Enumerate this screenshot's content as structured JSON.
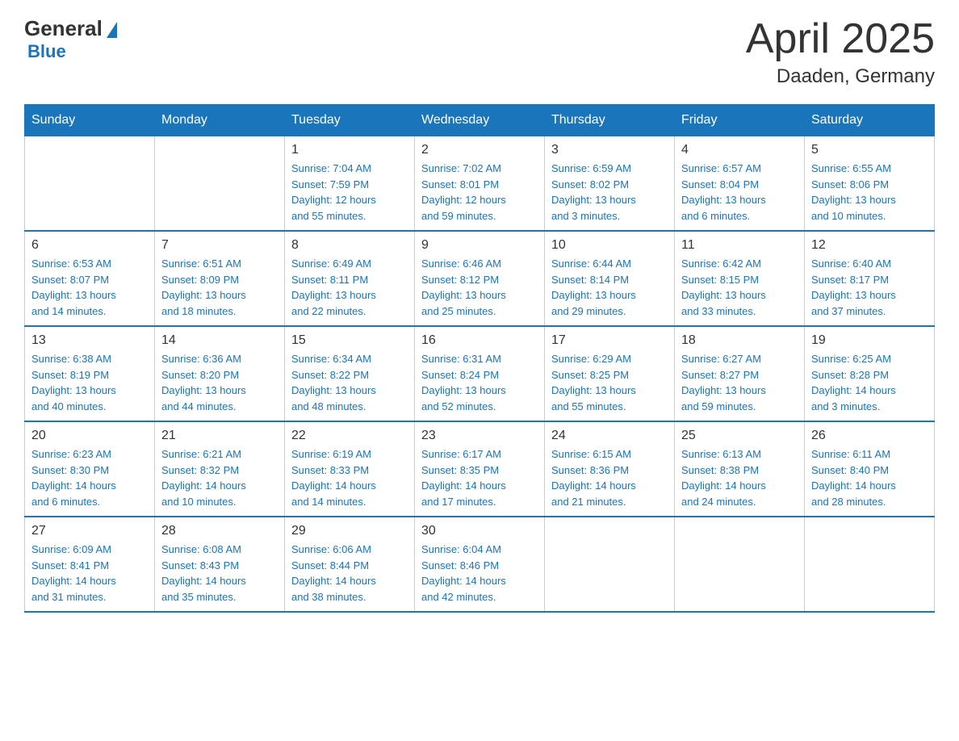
{
  "header": {
    "logo": {
      "general": "General",
      "blue": "Blue"
    },
    "title": "April 2025",
    "subtitle": "Daaden, Germany"
  },
  "calendar": {
    "days_of_week": [
      "Sunday",
      "Monday",
      "Tuesday",
      "Wednesday",
      "Thursday",
      "Friday",
      "Saturday"
    ],
    "weeks": [
      [
        {
          "day": "",
          "info": ""
        },
        {
          "day": "",
          "info": ""
        },
        {
          "day": "1",
          "info": "Sunrise: 7:04 AM\nSunset: 7:59 PM\nDaylight: 12 hours\nand 55 minutes."
        },
        {
          "day": "2",
          "info": "Sunrise: 7:02 AM\nSunset: 8:01 PM\nDaylight: 12 hours\nand 59 minutes."
        },
        {
          "day": "3",
          "info": "Sunrise: 6:59 AM\nSunset: 8:02 PM\nDaylight: 13 hours\nand 3 minutes."
        },
        {
          "day": "4",
          "info": "Sunrise: 6:57 AM\nSunset: 8:04 PM\nDaylight: 13 hours\nand 6 minutes."
        },
        {
          "day": "5",
          "info": "Sunrise: 6:55 AM\nSunset: 8:06 PM\nDaylight: 13 hours\nand 10 minutes."
        }
      ],
      [
        {
          "day": "6",
          "info": "Sunrise: 6:53 AM\nSunset: 8:07 PM\nDaylight: 13 hours\nand 14 minutes."
        },
        {
          "day": "7",
          "info": "Sunrise: 6:51 AM\nSunset: 8:09 PM\nDaylight: 13 hours\nand 18 minutes."
        },
        {
          "day": "8",
          "info": "Sunrise: 6:49 AM\nSunset: 8:11 PM\nDaylight: 13 hours\nand 22 minutes."
        },
        {
          "day": "9",
          "info": "Sunrise: 6:46 AM\nSunset: 8:12 PM\nDaylight: 13 hours\nand 25 minutes."
        },
        {
          "day": "10",
          "info": "Sunrise: 6:44 AM\nSunset: 8:14 PM\nDaylight: 13 hours\nand 29 minutes."
        },
        {
          "day": "11",
          "info": "Sunrise: 6:42 AM\nSunset: 8:15 PM\nDaylight: 13 hours\nand 33 minutes."
        },
        {
          "day": "12",
          "info": "Sunrise: 6:40 AM\nSunset: 8:17 PM\nDaylight: 13 hours\nand 37 minutes."
        }
      ],
      [
        {
          "day": "13",
          "info": "Sunrise: 6:38 AM\nSunset: 8:19 PM\nDaylight: 13 hours\nand 40 minutes."
        },
        {
          "day": "14",
          "info": "Sunrise: 6:36 AM\nSunset: 8:20 PM\nDaylight: 13 hours\nand 44 minutes."
        },
        {
          "day": "15",
          "info": "Sunrise: 6:34 AM\nSunset: 8:22 PM\nDaylight: 13 hours\nand 48 minutes."
        },
        {
          "day": "16",
          "info": "Sunrise: 6:31 AM\nSunset: 8:24 PM\nDaylight: 13 hours\nand 52 minutes."
        },
        {
          "day": "17",
          "info": "Sunrise: 6:29 AM\nSunset: 8:25 PM\nDaylight: 13 hours\nand 55 minutes."
        },
        {
          "day": "18",
          "info": "Sunrise: 6:27 AM\nSunset: 8:27 PM\nDaylight: 13 hours\nand 59 minutes."
        },
        {
          "day": "19",
          "info": "Sunrise: 6:25 AM\nSunset: 8:28 PM\nDaylight: 14 hours\nand 3 minutes."
        }
      ],
      [
        {
          "day": "20",
          "info": "Sunrise: 6:23 AM\nSunset: 8:30 PM\nDaylight: 14 hours\nand 6 minutes."
        },
        {
          "day": "21",
          "info": "Sunrise: 6:21 AM\nSunset: 8:32 PM\nDaylight: 14 hours\nand 10 minutes."
        },
        {
          "day": "22",
          "info": "Sunrise: 6:19 AM\nSunset: 8:33 PM\nDaylight: 14 hours\nand 14 minutes."
        },
        {
          "day": "23",
          "info": "Sunrise: 6:17 AM\nSunset: 8:35 PM\nDaylight: 14 hours\nand 17 minutes."
        },
        {
          "day": "24",
          "info": "Sunrise: 6:15 AM\nSunset: 8:36 PM\nDaylight: 14 hours\nand 21 minutes."
        },
        {
          "day": "25",
          "info": "Sunrise: 6:13 AM\nSunset: 8:38 PM\nDaylight: 14 hours\nand 24 minutes."
        },
        {
          "day": "26",
          "info": "Sunrise: 6:11 AM\nSunset: 8:40 PM\nDaylight: 14 hours\nand 28 minutes."
        }
      ],
      [
        {
          "day": "27",
          "info": "Sunrise: 6:09 AM\nSunset: 8:41 PM\nDaylight: 14 hours\nand 31 minutes."
        },
        {
          "day": "28",
          "info": "Sunrise: 6:08 AM\nSunset: 8:43 PM\nDaylight: 14 hours\nand 35 minutes."
        },
        {
          "day": "29",
          "info": "Sunrise: 6:06 AM\nSunset: 8:44 PM\nDaylight: 14 hours\nand 38 minutes."
        },
        {
          "day": "30",
          "info": "Sunrise: 6:04 AM\nSunset: 8:46 PM\nDaylight: 14 hours\nand 42 minutes."
        },
        {
          "day": "",
          "info": ""
        },
        {
          "day": "",
          "info": ""
        },
        {
          "day": "",
          "info": ""
        }
      ]
    ]
  }
}
